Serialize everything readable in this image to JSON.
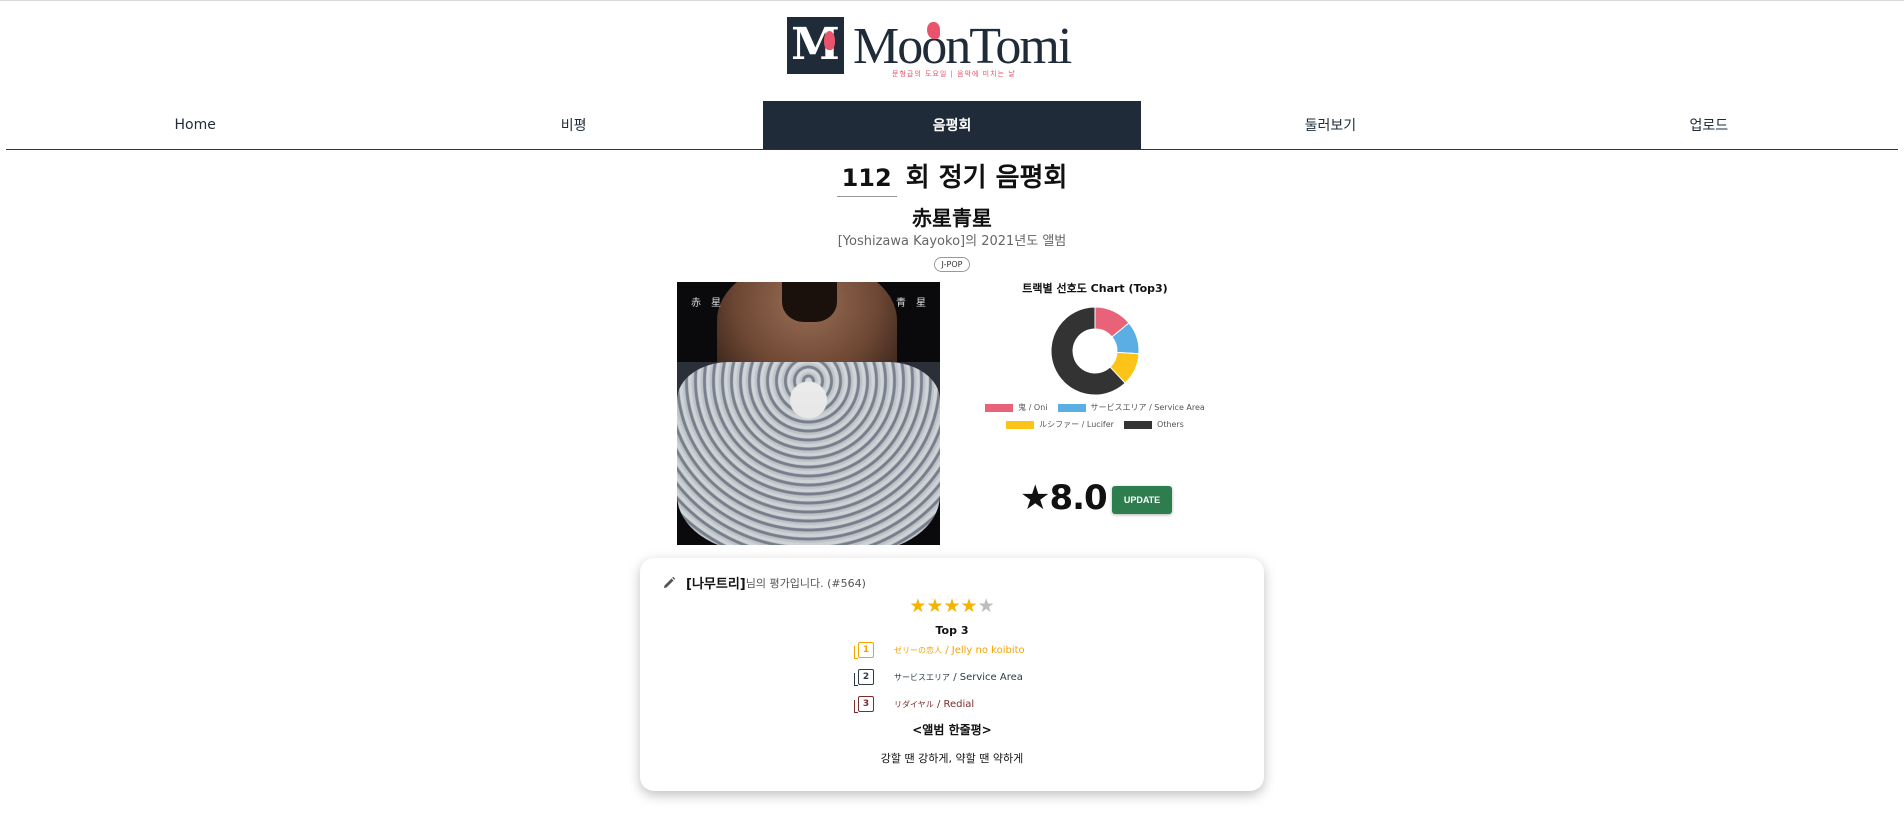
{
  "logo": {
    "mark": "M",
    "wordmark": "MoonTomi",
    "subtitle": "문형급의 도요일 | 음악에 미치는 날"
  },
  "nav": {
    "items": [
      "Home",
      "비평",
      "음평회",
      "둘러보기",
      "업로드"
    ],
    "active": "음평회"
  },
  "heading": {
    "issue_number": "112",
    "title": "회 정기 음평회"
  },
  "album": {
    "title": "赤星青星",
    "artist_line": "[Yoshizawa Kayoko]의 2021년도 앨범",
    "genre": "J-POP",
    "cover_text_left": "赤　星",
    "cover_text_right": "青　星"
  },
  "chart": {
    "title": "트랙별 선호도 Chart (Top3)"
  },
  "chart_data": {
    "type": "pie",
    "title": "트랙별 선호도 Chart (Top3)",
    "series": [
      {
        "name": "鬼 / Oni",
        "value": 14,
        "color": "#e8637a"
      },
      {
        "name": "サービスエリア / Service Area",
        "value": 12,
        "color": "#5aaee4"
      },
      {
        "name": "ルシファー / Lucifer",
        "value": 12,
        "color": "#fcc419"
      },
      {
        "name": "Others",
        "value": 62,
        "color": "#333333"
      }
    ],
    "legend_position": "bottom"
  },
  "score": {
    "value": "★8.0",
    "update_label": "UPDATE",
    "update_color": "#2e7d4f"
  },
  "review": {
    "reviewer": "[나무트리]",
    "suffix": "님의 평가입니다. (#564)",
    "rating": 4,
    "rating_max": 5,
    "top3_label": "Top 3",
    "tracks": [
      {
        "num": "1",
        "jp": "ゼリーの恋人",
        "en": "Jelly no koibito"
      },
      {
        "num": "2",
        "jp": "サービスエリア",
        "en": "Service Area"
      },
      {
        "num": "3",
        "jp": "リダイヤル",
        "en": "Redial"
      }
    ],
    "one_line_title": "<앨범 한줄평>",
    "one_line": "강할 땐 강하게, 약할 땐 약하게"
  }
}
